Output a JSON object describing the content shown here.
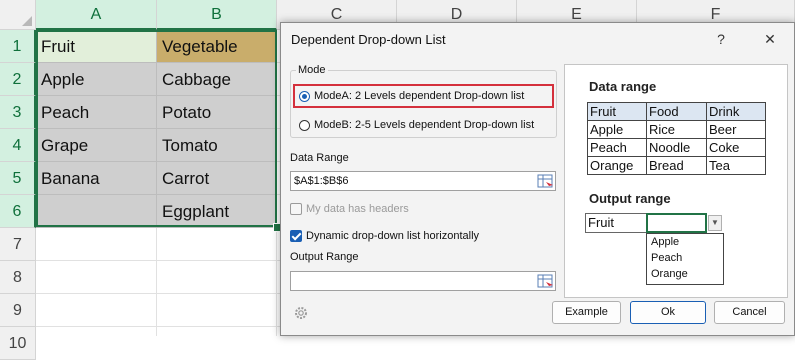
{
  "sheet": {
    "columns": [
      "A",
      "B",
      "C",
      "D",
      "E",
      "F"
    ],
    "rows": [
      "1",
      "2",
      "3",
      "4",
      "5",
      "6",
      "7",
      "8",
      "9",
      "10"
    ],
    "cells": {
      "a1": "Fruit",
      "b1": "Vegetable",
      "a2": "Apple",
      "b2": "Cabbage",
      "a3": "Peach",
      "b3": "Potato",
      "a4": "Grape",
      "b4": "Tomato",
      "a5": "Banana",
      "b5": "Carrot",
      "a6": "",
      "b6": "Eggplant"
    },
    "colors": {
      "header_fill_a1": "#e2efda",
      "header_fill_b1": "#c9ad6b",
      "data_fill": "#cfcfcf",
      "selection": "#217346"
    }
  },
  "dialog": {
    "title": "Dependent Drop-down List",
    "help_label": "?",
    "close_label": "✕",
    "mode": {
      "legend": "Mode",
      "option_a": "ModeA: 2 Levels dependent Drop-down list",
      "option_b": "ModeB: 2-5 Levels dependent Drop-down list",
      "selected": "ModeA"
    },
    "data_range": {
      "label": "Data Range",
      "value": "$A$1:$B$6"
    },
    "headers_checkbox": {
      "label": "My data has headers",
      "checked": false,
      "enabled": false
    },
    "horizontal_checkbox": {
      "label": "Dynamic drop-down list horizontally",
      "checked": true
    },
    "output_range": {
      "label": "Output Range",
      "value": ""
    },
    "buttons": {
      "example": "Example",
      "ok": "Ok",
      "cancel": "Cancel"
    },
    "icons": {
      "range_picker": "range-picker-icon",
      "settings": "gear-icon"
    }
  },
  "preview": {
    "data_range_title": "Data range",
    "table": [
      [
        "Fruit",
        "Food",
        "Drink"
      ],
      [
        "Apple",
        "Rice",
        "Beer"
      ],
      [
        "Peach",
        "Noodle",
        "Coke"
      ],
      [
        "Orange",
        "Bread",
        "Tea"
      ]
    ],
    "output_title": "Output range",
    "output_cell": "Fruit",
    "dropdown_options": [
      "Apple",
      "Peach",
      "Orange"
    ]
  }
}
